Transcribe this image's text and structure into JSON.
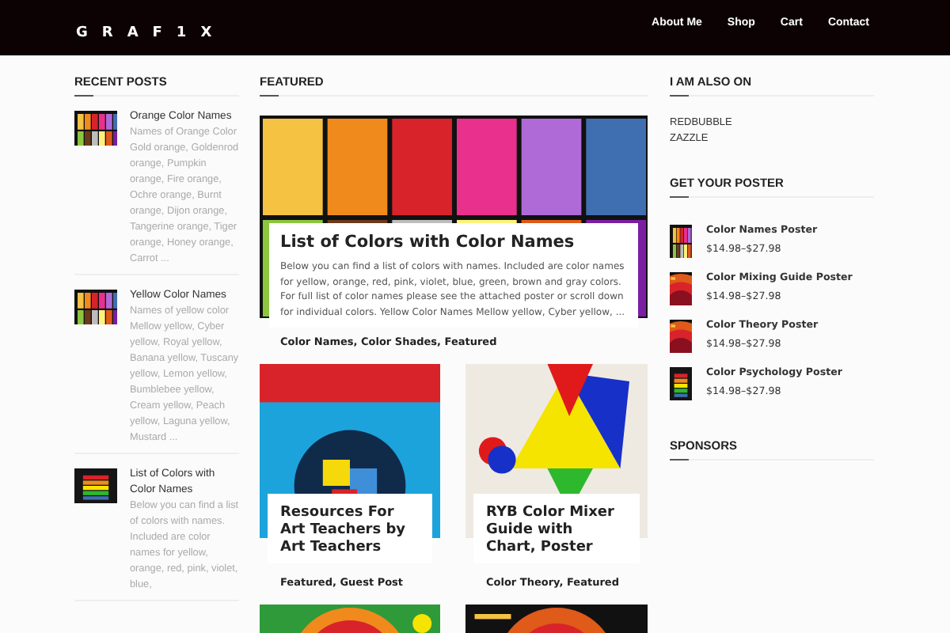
{
  "header": {
    "logo": "GRAF1X",
    "nav": [
      "About Me",
      "Shop",
      "Cart",
      "Contact"
    ]
  },
  "recent_posts": {
    "title": "RECENT POSTS",
    "items": [
      {
        "title": "Orange Color Names",
        "excerpt": "Names of Orange Color Gold orange, Goldenrod orange, Pumpkin orange, Fire orange, Ochre orange, Burnt orange, Dijon orange, Tangerine orange, Tiger orange, Honey orange, Carrot ..."
      },
      {
        "title": "Yellow Color Names",
        "excerpt": "Names of yellow color Mellow yellow, Cyber yellow, Royal yellow, Banana yellow, Tuscany yellow, Lemon yellow, Bumblebee yellow, Cream yellow, Peach yellow, Laguna yellow, Mustard ..."
      },
      {
        "title": "List of Colors with Color Names",
        "excerpt": "Below you can find a list of colors with names. Included are color names for yellow, orange, red, pink, violet, blue,"
      }
    ]
  },
  "featured": {
    "title": "FEATURED",
    "main": {
      "title": "List of Colors with Color Names",
      "excerpt": "Below you can find a list of colors with names. Included are color names for yellow, orange, red, pink, violet, blue, green, brown and gray colors. For full list of color names please see the attached poster or scroll down for individual colors. Yellow Color Names Mellow yellow, Cyber yellow, ...",
      "tags": "Color Names, Color Shades, Featured"
    },
    "cards": [
      {
        "title": "Resources For Art Teachers by Art Teachers",
        "tags": "Featured, Guest Post"
      },
      {
        "title": "RYB Color Mixer Guide with Chart, Poster",
        "tags": "Color Theory, Featured"
      }
    ]
  },
  "also_on": {
    "title": "I AM ALSO ON",
    "links": [
      "REDBUBBLE",
      "ZAZZLE"
    ]
  },
  "posters": {
    "title": "GET YOUR POSTER",
    "items": [
      {
        "name": "Color Names Poster",
        "price": "$14.98–$27.98"
      },
      {
        "name": "Color Mixing Guide Poster",
        "price": "$14.98–$27.98"
      },
      {
        "name": "Color Theory Poster",
        "price": "$14.98–$27.98"
      },
      {
        "name": "Color Psychology Poster",
        "price": "$14.98–$27.98"
      }
    ]
  },
  "sponsors": {
    "title": "SPONSORS"
  }
}
